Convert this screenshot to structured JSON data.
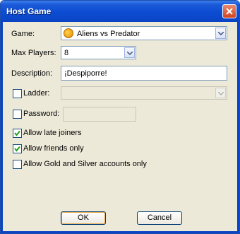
{
  "window": {
    "title": "Host Game",
    "close_icon": "close-icon"
  },
  "form": {
    "game": {
      "label": "Game:",
      "value": "Aliens vs Predator",
      "icon": "game-icon"
    },
    "max_players": {
      "label": "Max Players:",
      "value": "8"
    },
    "description": {
      "label": "Description:",
      "value": "¡Despiporre!"
    },
    "ladder": {
      "label": "Ladder:",
      "checked": false,
      "value": ""
    },
    "password": {
      "label": "Password:",
      "checked": false,
      "value": ""
    },
    "options": [
      {
        "label": "Allow late joiners",
        "checked": true
      },
      {
        "label": "Allow friends only",
        "checked": true
      },
      {
        "label": "Allow Gold and Silver accounts only",
        "checked": false
      }
    ]
  },
  "buttons": {
    "ok": "OK",
    "cancel": "Cancel"
  },
  "colors": {
    "titlebar": "#0c4cd2",
    "face": "#ece9d8",
    "close": "#d2431f",
    "check": "#21a121"
  }
}
